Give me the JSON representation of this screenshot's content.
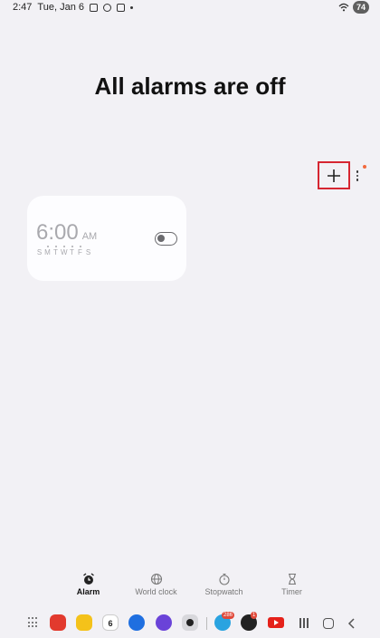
{
  "status_bar": {
    "time": "2:47",
    "date": "Tue, Jan 6",
    "battery": "74"
  },
  "main": {
    "title": "All alarms are off"
  },
  "alarm": {
    "time": "6:00",
    "ampm": "AM",
    "enabled": false,
    "days": [
      {
        "letter": "S",
        "active": false
      },
      {
        "letter": "M",
        "active": true
      },
      {
        "letter": "T",
        "active": true
      },
      {
        "letter": "W",
        "active": true
      },
      {
        "letter": "T",
        "active": true
      },
      {
        "letter": "F",
        "active": true
      },
      {
        "letter": "S",
        "active": false
      }
    ]
  },
  "tabs": [
    {
      "label": "Alarm",
      "icon": "alarm-clock-icon",
      "selected": true
    },
    {
      "label": "World clock",
      "icon": "globe-icon",
      "selected": false
    },
    {
      "label": "Stopwatch",
      "icon": "stopwatch-icon",
      "selected": false
    },
    {
      "label": "Timer",
      "icon": "hourglass-icon",
      "selected": false
    }
  ],
  "taskbar": {
    "calendar_day": "6",
    "telegram_badge": "286",
    "settings_badge": "1"
  },
  "colors": {
    "background": "#f2f1f5",
    "card": "#fdfdff",
    "highlight_box": "#d62631",
    "notification_dot": "#f26a3d"
  }
}
